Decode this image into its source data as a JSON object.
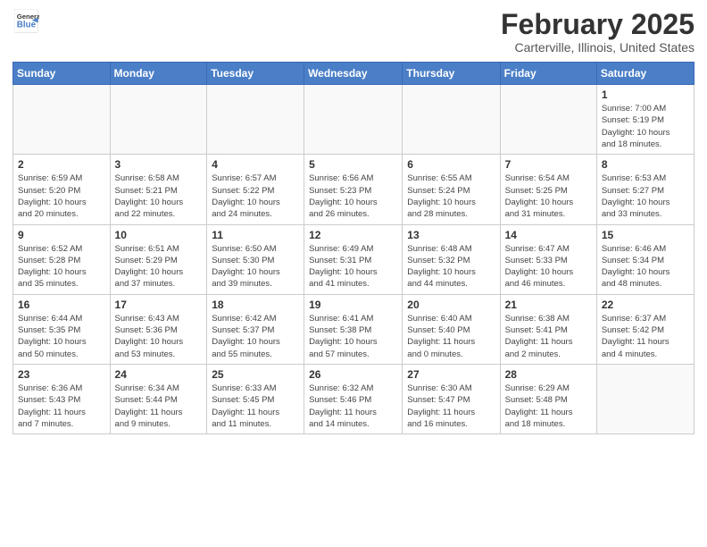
{
  "header": {
    "logo_line1": "General",
    "logo_line2": "Blue",
    "title": "February 2025",
    "subtitle": "Carterville, Illinois, United States"
  },
  "weekdays": [
    "Sunday",
    "Monday",
    "Tuesday",
    "Wednesday",
    "Thursday",
    "Friday",
    "Saturday"
  ],
  "weeks": [
    [
      {
        "day": "",
        "info": ""
      },
      {
        "day": "",
        "info": ""
      },
      {
        "day": "",
        "info": ""
      },
      {
        "day": "",
        "info": ""
      },
      {
        "day": "",
        "info": ""
      },
      {
        "day": "",
        "info": ""
      },
      {
        "day": "1",
        "info": "Sunrise: 7:00 AM\nSunset: 5:19 PM\nDaylight: 10 hours\nand 18 minutes."
      }
    ],
    [
      {
        "day": "2",
        "info": "Sunrise: 6:59 AM\nSunset: 5:20 PM\nDaylight: 10 hours\nand 20 minutes."
      },
      {
        "day": "3",
        "info": "Sunrise: 6:58 AM\nSunset: 5:21 PM\nDaylight: 10 hours\nand 22 minutes."
      },
      {
        "day": "4",
        "info": "Sunrise: 6:57 AM\nSunset: 5:22 PM\nDaylight: 10 hours\nand 24 minutes."
      },
      {
        "day": "5",
        "info": "Sunrise: 6:56 AM\nSunset: 5:23 PM\nDaylight: 10 hours\nand 26 minutes."
      },
      {
        "day": "6",
        "info": "Sunrise: 6:55 AM\nSunset: 5:24 PM\nDaylight: 10 hours\nand 28 minutes."
      },
      {
        "day": "7",
        "info": "Sunrise: 6:54 AM\nSunset: 5:25 PM\nDaylight: 10 hours\nand 31 minutes."
      },
      {
        "day": "8",
        "info": "Sunrise: 6:53 AM\nSunset: 5:27 PM\nDaylight: 10 hours\nand 33 minutes."
      }
    ],
    [
      {
        "day": "9",
        "info": "Sunrise: 6:52 AM\nSunset: 5:28 PM\nDaylight: 10 hours\nand 35 minutes."
      },
      {
        "day": "10",
        "info": "Sunrise: 6:51 AM\nSunset: 5:29 PM\nDaylight: 10 hours\nand 37 minutes."
      },
      {
        "day": "11",
        "info": "Sunrise: 6:50 AM\nSunset: 5:30 PM\nDaylight: 10 hours\nand 39 minutes."
      },
      {
        "day": "12",
        "info": "Sunrise: 6:49 AM\nSunset: 5:31 PM\nDaylight: 10 hours\nand 41 minutes."
      },
      {
        "day": "13",
        "info": "Sunrise: 6:48 AM\nSunset: 5:32 PM\nDaylight: 10 hours\nand 44 minutes."
      },
      {
        "day": "14",
        "info": "Sunrise: 6:47 AM\nSunset: 5:33 PM\nDaylight: 10 hours\nand 46 minutes."
      },
      {
        "day": "15",
        "info": "Sunrise: 6:46 AM\nSunset: 5:34 PM\nDaylight: 10 hours\nand 48 minutes."
      }
    ],
    [
      {
        "day": "16",
        "info": "Sunrise: 6:44 AM\nSunset: 5:35 PM\nDaylight: 10 hours\nand 50 minutes."
      },
      {
        "day": "17",
        "info": "Sunrise: 6:43 AM\nSunset: 5:36 PM\nDaylight: 10 hours\nand 53 minutes."
      },
      {
        "day": "18",
        "info": "Sunrise: 6:42 AM\nSunset: 5:37 PM\nDaylight: 10 hours\nand 55 minutes."
      },
      {
        "day": "19",
        "info": "Sunrise: 6:41 AM\nSunset: 5:38 PM\nDaylight: 10 hours\nand 57 minutes."
      },
      {
        "day": "20",
        "info": "Sunrise: 6:40 AM\nSunset: 5:40 PM\nDaylight: 11 hours\nand 0 minutes."
      },
      {
        "day": "21",
        "info": "Sunrise: 6:38 AM\nSunset: 5:41 PM\nDaylight: 11 hours\nand 2 minutes."
      },
      {
        "day": "22",
        "info": "Sunrise: 6:37 AM\nSunset: 5:42 PM\nDaylight: 11 hours\nand 4 minutes."
      }
    ],
    [
      {
        "day": "23",
        "info": "Sunrise: 6:36 AM\nSunset: 5:43 PM\nDaylight: 11 hours\nand 7 minutes."
      },
      {
        "day": "24",
        "info": "Sunrise: 6:34 AM\nSunset: 5:44 PM\nDaylight: 11 hours\nand 9 minutes."
      },
      {
        "day": "25",
        "info": "Sunrise: 6:33 AM\nSunset: 5:45 PM\nDaylight: 11 hours\nand 11 minutes."
      },
      {
        "day": "26",
        "info": "Sunrise: 6:32 AM\nSunset: 5:46 PM\nDaylight: 11 hours\nand 14 minutes."
      },
      {
        "day": "27",
        "info": "Sunrise: 6:30 AM\nSunset: 5:47 PM\nDaylight: 11 hours\nand 16 minutes."
      },
      {
        "day": "28",
        "info": "Sunrise: 6:29 AM\nSunset: 5:48 PM\nDaylight: 11 hours\nand 18 minutes."
      },
      {
        "day": "",
        "info": ""
      }
    ]
  ]
}
